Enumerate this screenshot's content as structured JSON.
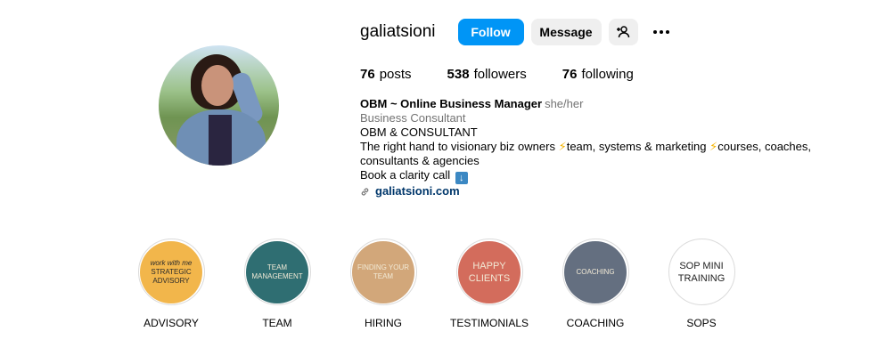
{
  "profile": {
    "username": "galiatsioni",
    "follow_label": "Follow",
    "message_label": "Message",
    "stats": {
      "posts_count": "76",
      "posts_label": "posts",
      "followers_count": "538",
      "followers_label": "followers",
      "following_count": "76",
      "following_label": "following"
    },
    "bio": {
      "name": "OBM ~ Online Business Manager",
      "pronouns": "she/her",
      "category": "Business Consultant",
      "line1": "OBM & CONSULTANT",
      "line2_a": "The right hand to visionary biz owners ",
      "line2_b": "team, systems & marketing ",
      "line2_c": "courses, coaches,",
      "line3": "consultants & agencies",
      "line4": "Book a clarity call ",
      "link": "galiatsioni.com"
    }
  },
  "highlights": [
    {
      "label": "ADVISORY",
      "cover_sub": "work with me",
      "cover_text": "STRATEGIC ADVISORY",
      "color": "#f2b64b"
    },
    {
      "label": "TEAM",
      "cover_text": "TEAM MANAGEMENT",
      "color": "#2f6e72"
    },
    {
      "label": "HIRING",
      "cover_text": "FINDING YOUR TEAM",
      "color": "#d2a77a"
    },
    {
      "label": "TESTIMONIALS",
      "cover_text": "HAPPY CLIENTS",
      "color": "#d36c5c"
    },
    {
      "label": "COACHING",
      "cover_text": "COACHING",
      "color": "#646f80"
    },
    {
      "label": "SOPS",
      "cover_text": "SOP MINI TRAINING",
      "color": "#ffffff"
    }
  ],
  "colors": {
    "accent": "#0095f6",
    "secondary_button": "#efefef",
    "link": "#00376b"
  },
  "icons": [
    "add-user-icon",
    "more-options-icon",
    "link-icon",
    "lightning-icon",
    "down-arrow-icon"
  ]
}
